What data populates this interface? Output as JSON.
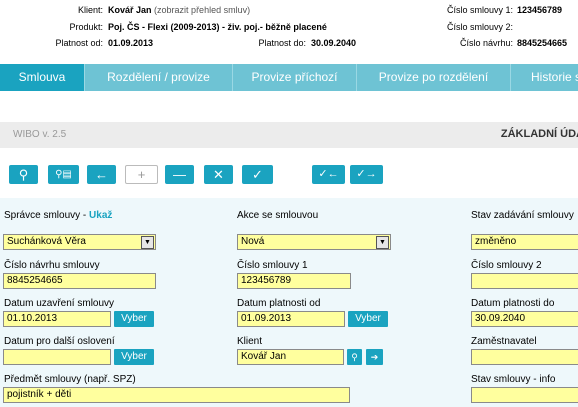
{
  "header": {
    "client_label": "Klient:",
    "client_value": "Kovář Jan",
    "client_link": "(zobrazit přehled smluv)",
    "product_label": "Produkt:",
    "product_value": "Poj. ČS - Flexi (2009-2013) - živ. poj.- běžně placené",
    "valid_from_label": "Platnost od:",
    "valid_from_value": "01.09.2013",
    "valid_to_label": "Platnost do:",
    "valid_to_value": "30.09.2040",
    "contract1_label": "Číslo smlouvy 1:",
    "contract1_value": "123456789",
    "contract2_label": "Číslo smlouvy 2:",
    "contract2_value": "",
    "proposal_label": "Číslo návrhu:",
    "proposal_value": "8845254665"
  },
  "tabs": [
    {
      "label": "Smlouva",
      "active": true
    },
    {
      "label": "Rozdělení / provize",
      "active": false
    },
    {
      "label": "Provize příchozí",
      "active": false
    },
    {
      "label": "Provize po rozdělení",
      "active": false
    },
    {
      "label": "Historie s",
      "active": false
    }
  ],
  "verbar": {
    "version": "WIBO v. 2.5",
    "title": "ZÁKLADNÍ ÚDA"
  },
  "toolbar": {
    "icons": [
      "search-icon",
      "search-document-icon",
      "arrow-left-icon",
      "plus-icon",
      "minus-icon",
      "close-icon",
      "check-icon",
      "check-left-icon",
      "check-right-icon"
    ],
    "glyphs": {
      "search": "⚲",
      "search_doc": "⚲▤",
      "left": "←",
      "plus": "+",
      "minus": "—",
      "close": "✕",
      "check": "✓",
      "check_left": "✓←",
      "check_right": "✓→"
    }
  },
  "form": {
    "spravce_label": "Správce smlouvy - ",
    "spravce_link": "Ukaž",
    "spravce_value": "Suchánková Věra",
    "akce_label": "Akce se smlouvou",
    "akce_value": "Nová",
    "stav_label": "Stav zadávání smlouvy",
    "stav_value": "změněno",
    "cislo_navrhu_label": "Číslo návrhu smlouvy",
    "cislo_navrhu_value": "8845254665",
    "cislo1_label": "Číslo smlouvy 1",
    "cislo1_value": "123456789",
    "cislo2_label": "Číslo smlouvy 2",
    "cislo2_value": "",
    "uzavreni_label": "Datum uzavření smlouvy",
    "uzavreni_value": "01.10.2013",
    "platnost_od_label": "Datum platnosti od",
    "platnost_od_value": "01.09.2013",
    "platnost_do_label": "Datum platnosti do",
    "platnost_do_value": "30.09.2040",
    "osloveni_label": "Datum pro další oslovení",
    "osloveni_value": "",
    "klient_label": "Klient",
    "klient_value": "Kovář Jan",
    "zamestnavatel_label": "Zaměstnavatel",
    "zamestnavatel_value": "",
    "predmet_label": "Předmět smlouvy (např. SPZ)",
    "predmet_value": "pojistník + děti",
    "stav_info_label": "Stav smlouvy - info",
    "stav_info_value": "",
    "vyber_label": "Vyber",
    "dropdown_glyph": "▼",
    "search_glyph": "⚲",
    "arrow_glyph": "➔"
  },
  "colors": {
    "accent": "#1aa3c0",
    "tabbar": "#6ec3d4",
    "input": "#ffff9e",
    "form_bg": "#eef8fb"
  }
}
